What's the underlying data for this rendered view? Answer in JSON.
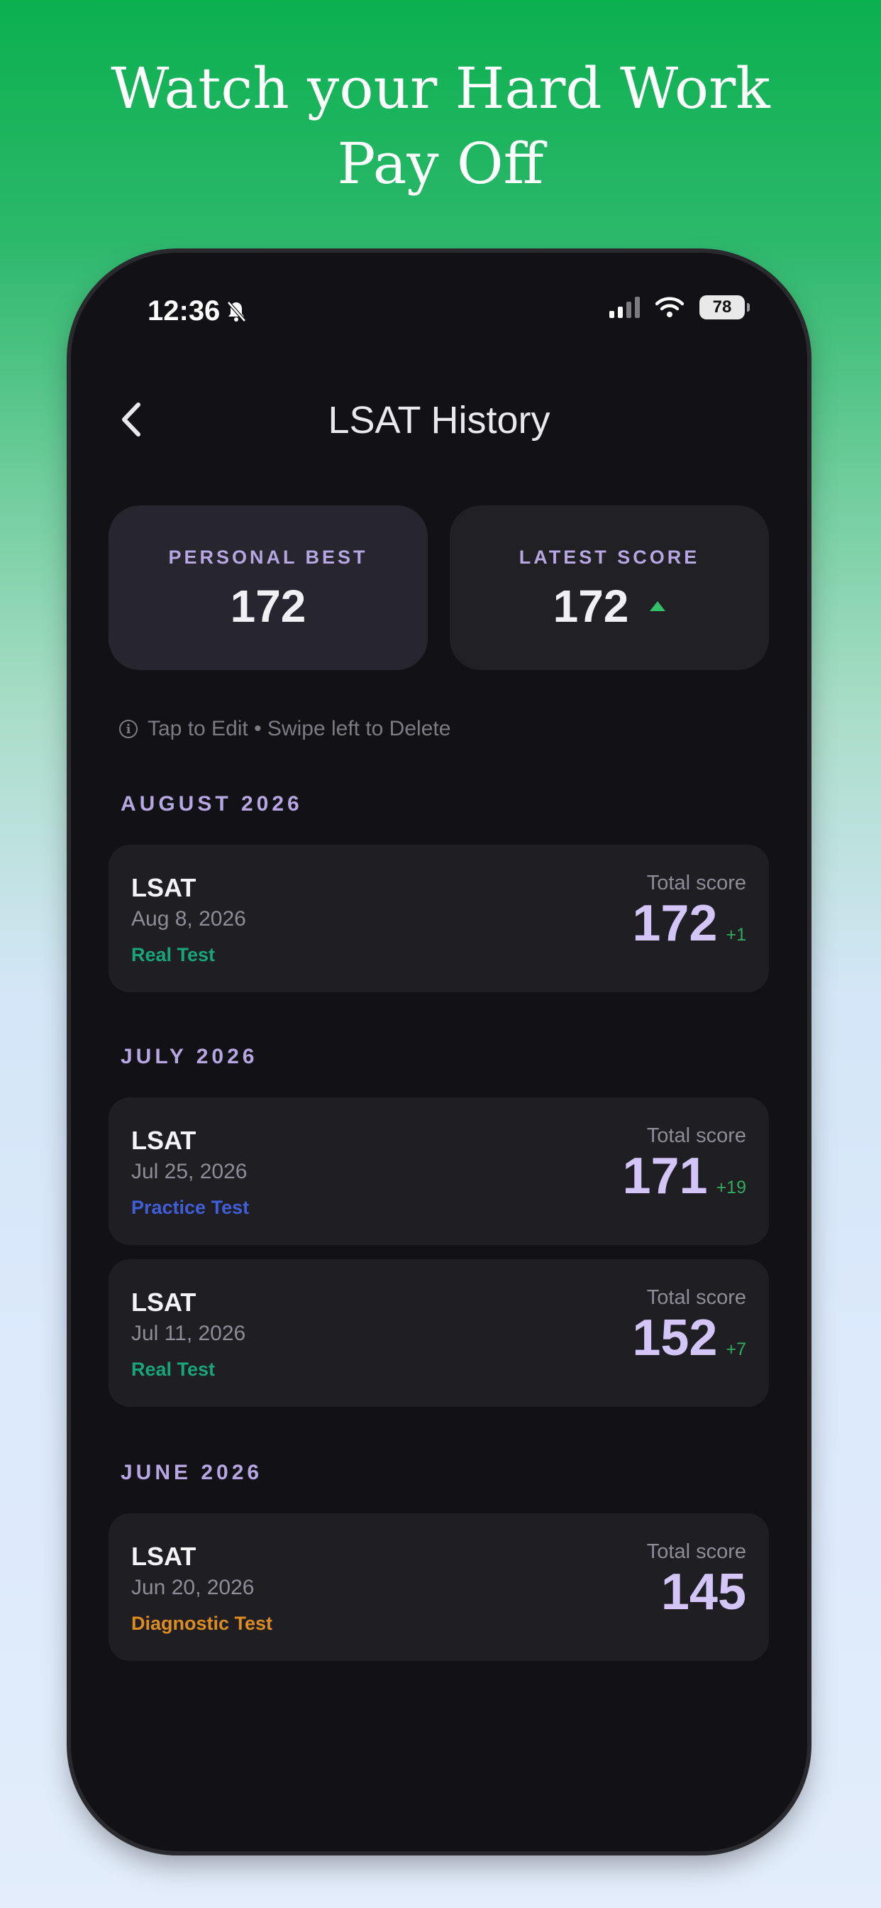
{
  "headline": {
    "line1": "Watch your Hard Work",
    "line2": "Pay Off"
  },
  "status_bar": {
    "time": "12:36",
    "battery": "78"
  },
  "nav": {
    "title": "LSAT History"
  },
  "stats": {
    "personal_best": {
      "label": "PERSONAL BEST",
      "value": "172"
    },
    "latest_score": {
      "label": "LATEST SCORE",
      "value": "172"
    }
  },
  "hint": "Tap to Edit • Swipe left to Delete",
  "colors": {
    "real_test": "#17a57b",
    "practice_test": "#3f5ed8",
    "diagnostic_test": "#dd8d1f",
    "accent_purple": "#d4c5f8",
    "delta_green": "#31ac5d"
  },
  "sections": [
    {
      "title": "AUGUST 2026",
      "entries": [
        {
          "name": "LSAT",
          "date": "Aug 8, 2026",
          "type": "Real Test",
          "total_label": "Total score",
          "score": "172",
          "delta": "+1"
        }
      ]
    },
    {
      "title": "JULY 2026",
      "entries": [
        {
          "name": "LSAT",
          "date": "Jul 25, 2026",
          "type": "Practice Test",
          "total_label": "Total score",
          "score": "171",
          "delta": "+19"
        },
        {
          "name": "LSAT",
          "date": "Jul 11, 2026",
          "type": "Real Test",
          "total_label": "Total score",
          "score": "152",
          "delta": "+7"
        }
      ]
    },
    {
      "title": "JUNE 2026",
      "entries": [
        {
          "name": "LSAT",
          "date": "Jun 20, 2026",
          "type": "Diagnostic Test",
          "total_label": "Total score",
          "score": "145",
          "delta": ""
        }
      ]
    }
  ]
}
